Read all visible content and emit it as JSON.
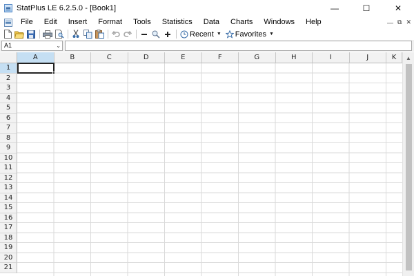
{
  "window": {
    "title": "StatPlus LE 6.2.5.0  - [Book1]",
    "minimize_glyph": "—",
    "maximize_glyph": "☐",
    "close_glyph": "✕"
  },
  "menu": {
    "items": [
      "File",
      "Edit",
      "Insert",
      "Format",
      "Tools",
      "Statistics",
      "Data",
      "Charts",
      "Windows",
      "Help"
    ],
    "mdi_minimize": "—",
    "mdi_restore": "⧉",
    "mdi_close": "✕"
  },
  "toolbar": {
    "icons": [
      "new-document-icon",
      "open-folder-icon",
      "save-icon",
      "print-icon",
      "print-preview-icon",
      "cut-icon",
      "copy-icon",
      "paste-icon",
      "undo-icon",
      "redo-icon",
      "zoom-out-icon",
      "zoom-icon",
      "zoom-in-icon"
    ],
    "recent_label": "Recent",
    "favorites_label": "Favorites"
  },
  "formula_bar": {
    "name_box_value": "A1",
    "formula_value": ""
  },
  "grid": {
    "columns": [
      "A",
      "B",
      "C",
      "D",
      "E",
      "F",
      "G",
      "H",
      "I",
      "J",
      "K"
    ],
    "rows": [
      "1",
      "2",
      "3",
      "4",
      "5",
      "6",
      "7",
      "8",
      "9",
      "10",
      "11",
      "12",
      "13",
      "14",
      "15",
      "16",
      "17",
      "18",
      "19",
      "20",
      "21"
    ],
    "active_cell": "A1"
  },
  "colors": {
    "header_bg": "#f2f2f2",
    "header_active_bg": "#c5dff3",
    "grid_line": "#dadada",
    "accent_blue": "#3a78c2"
  }
}
